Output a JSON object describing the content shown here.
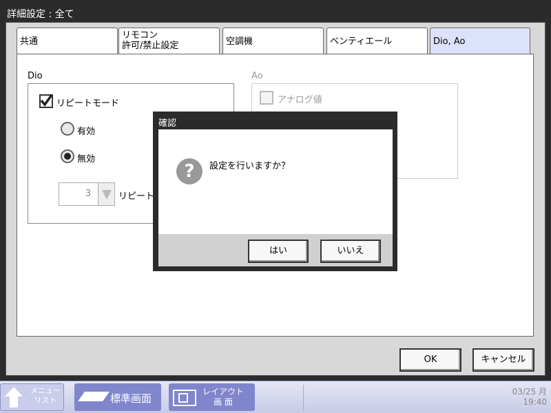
{
  "window": {
    "title": "詳細設定 : 全て"
  },
  "tabs": [
    {
      "label": "共通"
    },
    {
      "label_line1": "リモコン",
      "label_line2": "許可/禁止設定"
    },
    {
      "label": "空調機"
    },
    {
      "label": "ベンティエール"
    },
    {
      "label": "Dio, Ao",
      "active": true
    }
  ],
  "dio": {
    "section_label": "Dio",
    "repeat_mode_label": "リピートモード",
    "repeat_mode_checked": true,
    "radio_enabled_label": "有効",
    "radio_disabled_label": "無効",
    "selected": "無効",
    "stepper_value": "3",
    "stepper_label": "リピート|"
  },
  "ao": {
    "section_label": "Ao",
    "analog_label": "アナログ値",
    "analog_checked": false
  },
  "buttons": {
    "ok": "OK",
    "cancel": "キャンセル"
  },
  "dialog": {
    "title": "確認",
    "message": "設定を行いますか？",
    "icon": "question-icon",
    "yes": "はい",
    "no": "いいえ"
  },
  "taskbar": {
    "menu_line1": "メニュー",
    "menu_line2": "リスト",
    "standard_screen": "標準画面",
    "layout_line1": "レイアウト",
    "layout_line2": "画 面",
    "date": "03/25 月",
    "time": "19:40"
  },
  "colors": {
    "accent": "#7f86cc",
    "active_tab": "#dde2fb",
    "dialog_frame": "#2b2b2b"
  }
}
